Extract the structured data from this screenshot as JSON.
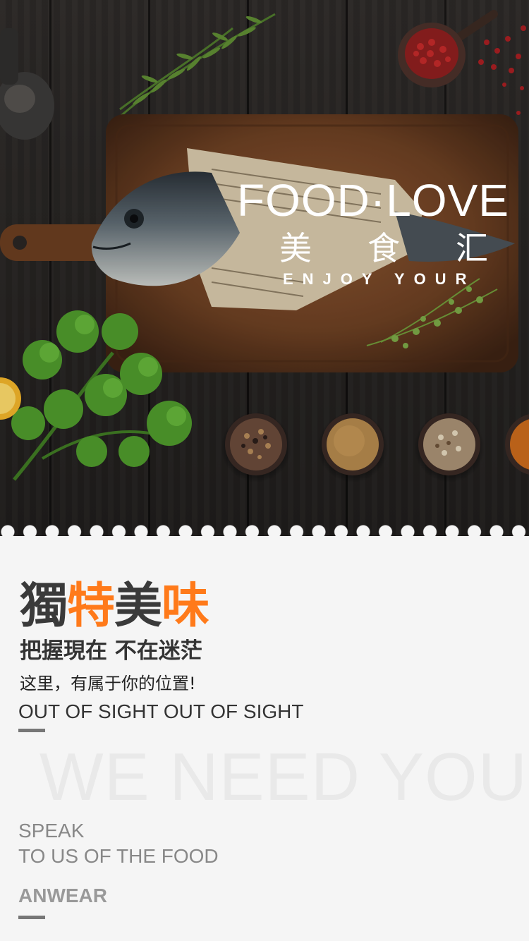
{
  "hero": {
    "title": "FOOD·LOVE",
    "chinese_title": [
      "美",
      "食",
      "汇"
    ],
    "subtitle": "ENJOY YOUR"
  },
  "card": {
    "headline": [
      {
        "text": "獨",
        "color": "#3a3a3a"
      },
      {
        "text": "特",
        "color": "#ff7a1a"
      },
      {
        "text": "美",
        "color": "#3a3a3a"
      },
      {
        "text": "味",
        "color": "#ff7a1a"
      }
    ],
    "subhead": "把握現在 不在迷茫",
    "tagline": "这里，有属于你的位置!",
    "english_line": "OUT OF SIGHT OUT OF SIGHT",
    "watermark": "WE NEED YOU",
    "speak_lines": [
      "SPEAK",
      "TO US OF THE FOOD"
    ],
    "signature": "ANWEAR"
  },
  "colors": {
    "accent": "#ff7a1a",
    "dark_text": "#3a3a3a",
    "background": "#f5f5f5",
    "wood": "#6b3f22"
  },
  "icons": [
    "fish-image",
    "cutting-board-image",
    "herb-image",
    "spice-bowl-image"
  ]
}
